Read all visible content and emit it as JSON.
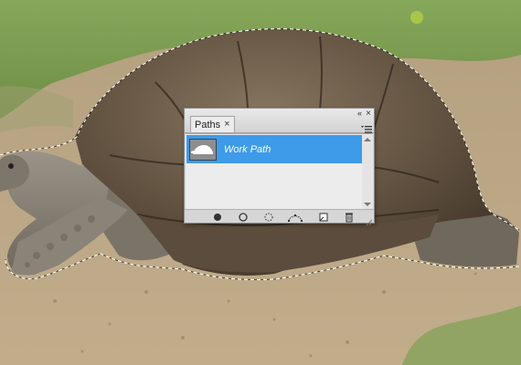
{
  "scene": {
    "image_label": "photo of a giant tortoise with an active selection outline",
    "colors": {
      "grass": "#7a9a4e",
      "ground": "#b9a382",
      "shell": "#6d5a47",
      "skin": "#8c857a"
    }
  },
  "panel": {
    "tab_label": "Paths",
    "tab_close_glyph": "×",
    "close_glyph": "×",
    "collapse_glyph": "«",
    "menu_icon": "panel-menu-icon",
    "rows": [
      {
        "label": "Work Path",
        "selected": true,
        "thumbnail_icon": "tortoise-silhouette-icon"
      }
    ],
    "toolbar": [
      {
        "name": "fill-path-icon"
      },
      {
        "name": "stroke-path-icon"
      },
      {
        "name": "load-path-as-selection-icon"
      },
      {
        "name": "make-work-path-icon"
      },
      {
        "name": "create-new-path-icon"
      },
      {
        "name": "delete-path-icon"
      }
    ],
    "colors": {
      "selected_row": "#3d9be9",
      "panel_bg": "#d6d6d6",
      "list_bg": "#ececec"
    }
  }
}
